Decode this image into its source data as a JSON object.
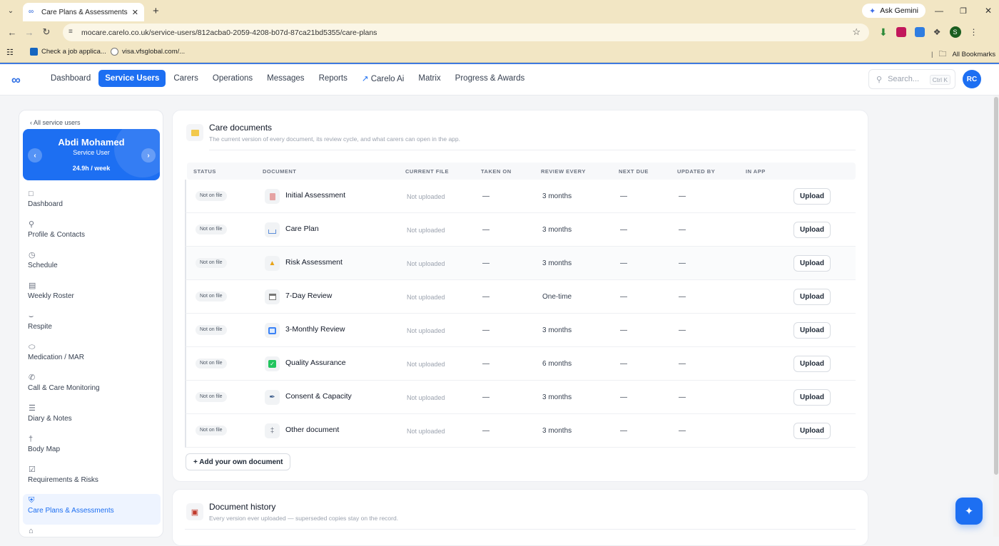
{
  "browser": {
    "tab_title": "Care Plans & Assessments — C",
    "url": "mocare.carelo.co.uk/service-users/812acba0-2059-4208-b07d-87ca21bd5355/care-plans",
    "ask_gemini": "Ask Gemini",
    "bookmarks": [
      "Check a job applica...",
      "visa.vfsglobal.com/..."
    ],
    "all_bookmarks": "All Bookmarks",
    "profile_initial": "S"
  },
  "header": {
    "nav": [
      "Dashboard",
      "Service Users",
      "Carers",
      "Operations",
      "Messages",
      "Reports",
      "Carelo Ai",
      "Matrix",
      "Progress & Awards"
    ],
    "active_nav": "Service Users",
    "search_placeholder": "Search...",
    "search_shortcut": "Ctrl K",
    "avatar": "RC"
  },
  "sidebar": {
    "back_link": "‹ All service users",
    "user_name": "Abdi Mohamed",
    "user_role": "Service User",
    "hours": "24.9h / week",
    "items": [
      {
        "label": "Dashboard",
        "icon": "calendar-icon"
      },
      {
        "label": "Profile & Contacts",
        "icon": "person-icon"
      },
      {
        "label": "Schedule",
        "icon": "clock-icon"
      },
      {
        "label": "Weekly Roster",
        "icon": "roster-icon"
      },
      {
        "label": "Respite",
        "icon": "bed-icon"
      },
      {
        "label": "Medication / MAR",
        "icon": "pill-icon"
      },
      {
        "label": "Call & Care Monitoring",
        "icon": "phone-icon"
      },
      {
        "label": "Diary & Notes",
        "icon": "notes-icon"
      },
      {
        "label": "Body Map",
        "icon": "body-icon"
      },
      {
        "label": "Requirements & Risks",
        "icon": "checkbox-icon"
      },
      {
        "label": "Care Plans & Assessments",
        "icon": "shield-icon"
      }
    ],
    "active_item": "Care Plans & Assessments"
  },
  "care_documents": {
    "title": "Care documents",
    "subtitle": "The current version of every document, its review cycle, and what carers can open in the app.",
    "columns": [
      "STATUS",
      "DOCUMENT",
      "CURRENT FILE",
      "TAKEN ON",
      "REVIEW EVERY",
      "NEXT DUE",
      "UPDATED BY",
      "IN APP"
    ],
    "rows": [
      {
        "status": "Not on file",
        "document": "Initial Assessment",
        "icon": "clipboard-icon",
        "current_file": "Not uploaded",
        "taken_on": "—",
        "review_every": "3 months",
        "next_due": "—",
        "updated_by": "—",
        "action": "Upload"
      },
      {
        "status": "Not on file",
        "document": "Care Plan",
        "icon": "book-icon",
        "current_file": "Not uploaded",
        "taken_on": "—",
        "review_every": "3 months",
        "next_due": "—",
        "updated_by": "—",
        "action": "Upload"
      },
      {
        "status": "Not on file",
        "document": "Risk Assessment",
        "icon": "warning-icon",
        "current_file": "Not uploaded",
        "taken_on": "—",
        "review_every": "3 months",
        "next_due": "—",
        "updated_by": "—",
        "action": "Upload"
      },
      {
        "status": "Not on file",
        "document": "7-Day Review",
        "icon": "calendar-icon",
        "current_file": "Not uploaded",
        "taken_on": "—",
        "review_every": "One-time",
        "next_due": "—",
        "updated_by": "—",
        "action": "Upload"
      },
      {
        "status": "Not on file",
        "document": "3-Monthly Review",
        "icon": "refresh-calendar-icon",
        "current_file": "Not uploaded",
        "taken_on": "—",
        "review_every": "3 months",
        "next_due": "—",
        "updated_by": "—",
        "action": "Upload"
      },
      {
        "status": "Not on file",
        "document": "Quality Assurance",
        "icon": "check-icon",
        "current_file": "Not uploaded",
        "taken_on": "—",
        "review_every": "6 months",
        "next_due": "—",
        "updated_by": "—",
        "action": "Upload"
      },
      {
        "status": "Not on file",
        "document": "Consent & Capacity",
        "icon": "pen-icon",
        "current_file": "Not uploaded",
        "taken_on": "—",
        "review_every": "3 months",
        "next_due": "—",
        "updated_by": "—",
        "action": "Upload"
      },
      {
        "status": "Not on file",
        "document": "Other document",
        "icon": "paperclip-icon",
        "current_file": "Not uploaded",
        "taken_on": "—",
        "review_every": "3 months",
        "next_due": "—",
        "updated_by": "—",
        "action": "Upload"
      }
    ],
    "add_button": "+ Add your own document"
  },
  "document_history": {
    "title": "Document history",
    "subtitle": "Every version ever uploaded — superseded copies stay on the record."
  }
}
